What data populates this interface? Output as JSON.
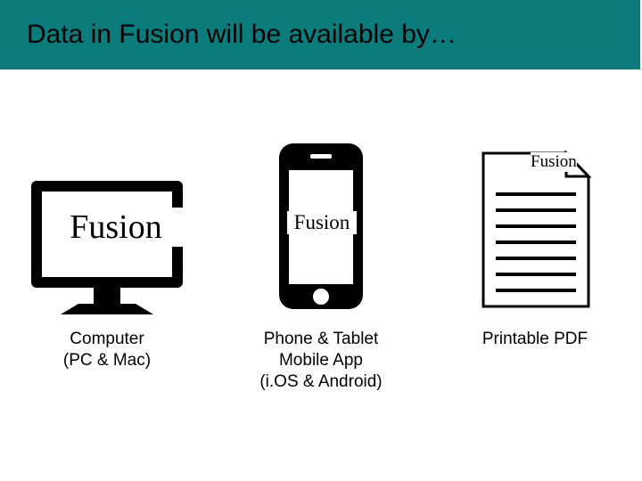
{
  "slide": {
    "title": "Data in Fusion will be available by…"
  },
  "columns": [
    {
      "overlay": "Fusion",
      "caption_lines": [
        "Computer",
        "(PC & Mac)"
      ]
    },
    {
      "overlay": "Fusion",
      "caption_lines": [
        "Phone & Tablet",
        "Mobile App",
        "(i.OS & Android)"
      ]
    },
    {
      "overlay": "Fusion",
      "caption_lines": [
        "Printable PDF"
      ]
    }
  ]
}
